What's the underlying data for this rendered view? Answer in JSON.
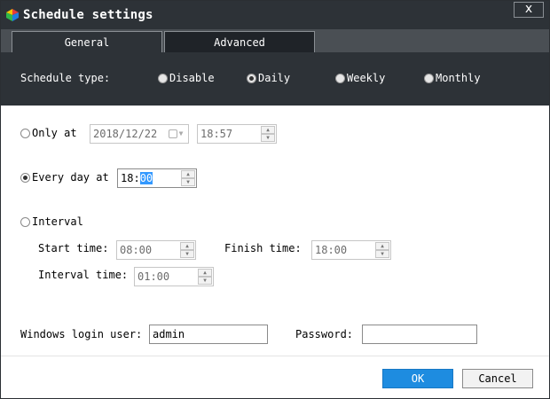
{
  "window": {
    "title": "Schedule settings",
    "close_label": "x"
  },
  "tabs": [
    {
      "label": "General",
      "selected": true
    },
    {
      "label": "Advanced",
      "selected": false
    }
  ],
  "schedule_type": {
    "label": "Schedule type:",
    "options": [
      {
        "label": "Disable",
        "selected": false
      },
      {
        "label": "Daily",
        "selected": true
      },
      {
        "label": "Weekly",
        "selected": false
      },
      {
        "label": "Monthly",
        "selected": false
      }
    ]
  },
  "only_at": {
    "label": "Only at",
    "date": "2018/12/22",
    "time": "18:57",
    "selected": false
  },
  "every_day": {
    "label": "Every day at",
    "hour": "18",
    "separator": ":",
    "minute": "00",
    "selected": true
  },
  "interval": {
    "label": "Interval",
    "selected": false,
    "start_label": "Start time:",
    "start_value": "08:00",
    "finish_label": "Finish time:",
    "finish_value": "18:00",
    "interval_label": "Interval time:",
    "interval_value": "01:00"
  },
  "login": {
    "user_label": "Windows login user:",
    "user_value": "admin",
    "password_label": "Password:",
    "password_value": ""
  },
  "footer": {
    "ok_label": "OK",
    "cancel_label": "Cancel"
  },
  "colors": {
    "titlebar": "#2d3237",
    "ok_button": "#1e8ce0",
    "selection": "#3399ff"
  }
}
